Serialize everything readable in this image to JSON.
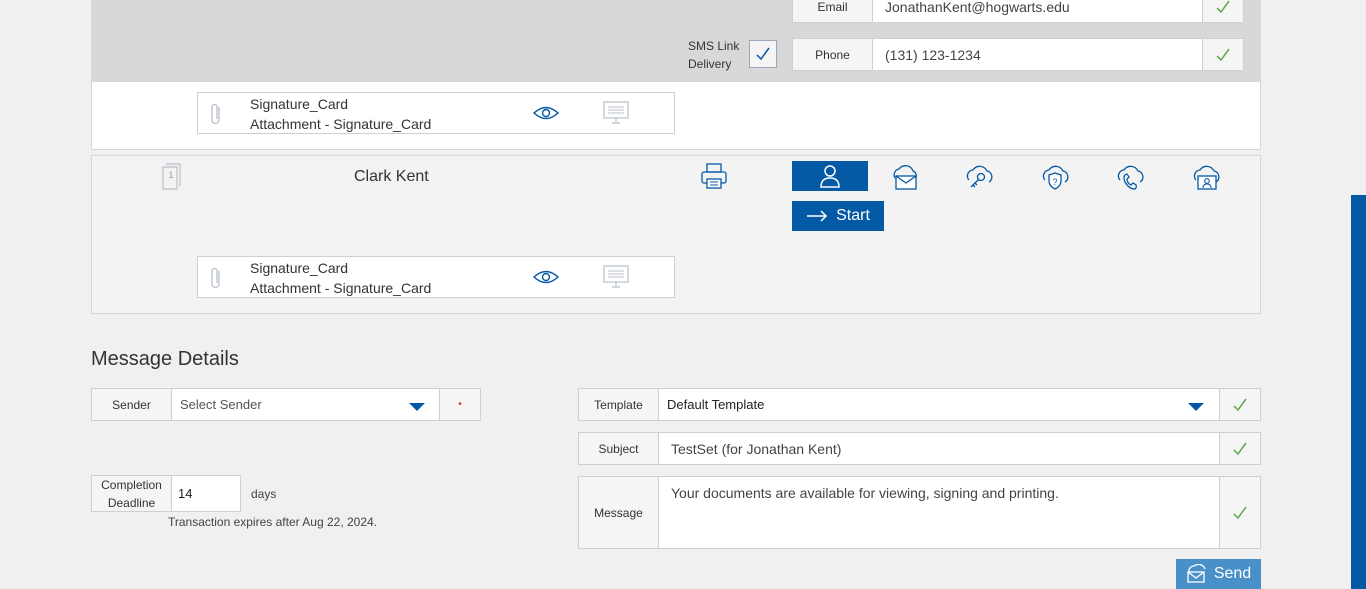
{
  "contact": {
    "email_label": "Email",
    "email_value": "JonathanKent@hogwarts.edu",
    "sms_label_line1": "SMS Link",
    "sms_label_line2": "Delivery",
    "phone_label": "Phone",
    "phone_value": "(131) 123-1234"
  },
  "attachment1": {
    "name": "Signature_Card",
    "subtitle": "Attachment - Signature_Card"
  },
  "signer": {
    "name": "Clark Kent",
    "order_number": "1",
    "start_label": "Start"
  },
  "attachment2": {
    "name": "Signature_Card",
    "subtitle": "Attachment - Signature_Card"
  },
  "message_details": {
    "heading": "Message Details",
    "sender_label": "Sender",
    "sender_placeholder": "Select Sender",
    "required_marker": "•",
    "template_label": "Template",
    "template_value": "Default Template",
    "subject_label": "Subject",
    "subject_value": "TestSet (for Jonathan Kent)",
    "message_label": "Message",
    "message_value": "Your documents are available for viewing, signing and printing.",
    "deadline_label_line1": "Completion",
    "deadline_label_line2": "Deadline",
    "deadline_value": "14",
    "deadline_unit": "days",
    "expiry_text": "Transaction expires after Aug 22, 2024.",
    "send_label": "Send"
  },
  "colors": {
    "brand_blue": "#0459a5",
    "check_green": "#5fa84a",
    "send_blue": "#4a90c8"
  }
}
